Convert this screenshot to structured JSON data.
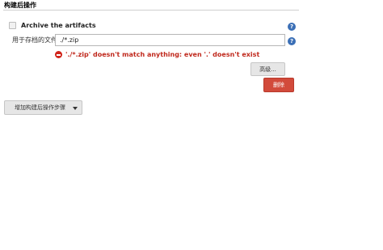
{
  "section": {
    "title": "构建后操作"
  },
  "archive": {
    "checkbox_label": "Archive the artifacts"
  },
  "files_field": {
    "label": "用于存档的文件",
    "value": "./*.zip"
  },
  "error": {
    "message": "'./*.zip' doesn't match anything: even '.' doesn't exist"
  },
  "buttons": {
    "advanced": "高级...",
    "delete": "删除",
    "add_post_build": "增加构建后操作步骤"
  },
  "help_icon_glyph": "?",
  "colors": {
    "error": "#c0291d",
    "delete_button": "#d24a3b",
    "help_icon": "#3b6fb6"
  }
}
